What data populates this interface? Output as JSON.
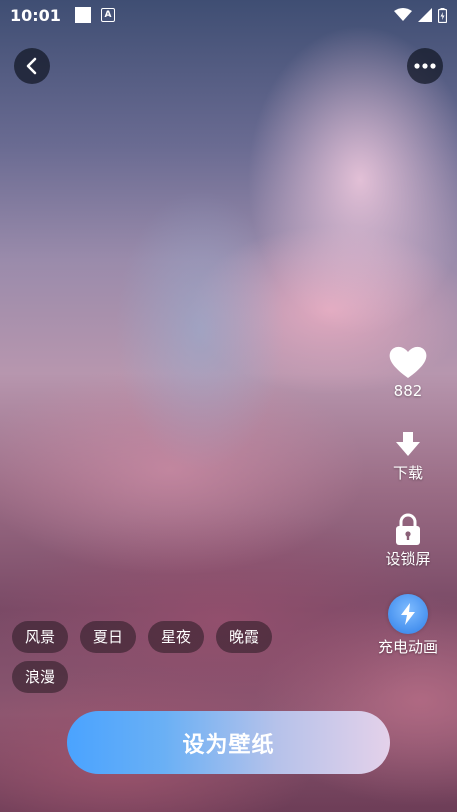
{
  "status_bar": {
    "time": "10:01",
    "notification_icon_letter": "A"
  },
  "toolbar": {
    "back_icon": "chevron-left-icon",
    "more_icon": "more-horizontal-icon"
  },
  "side_actions": {
    "like": {
      "icon": "heart-icon",
      "count": "882"
    },
    "download": {
      "icon": "download-icon",
      "label": "下载"
    },
    "lock_screen": {
      "icon": "lock-icon",
      "label": "设锁屏"
    },
    "charge_animation": {
      "icon": "lightning-icon",
      "label": "充电动画"
    }
  },
  "tags": [
    "风景",
    "夏日",
    "星夜",
    "晚霞",
    "浪漫"
  ],
  "cta": {
    "label": "设为壁纸"
  },
  "colors": {
    "cta_gradient_start": "#4aa3ff",
    "cta_gradient_end": "#e4d1ea",
    "charge_badge": "#2f7fe8",
    "top_button_bg": "#141928"
  }
}
